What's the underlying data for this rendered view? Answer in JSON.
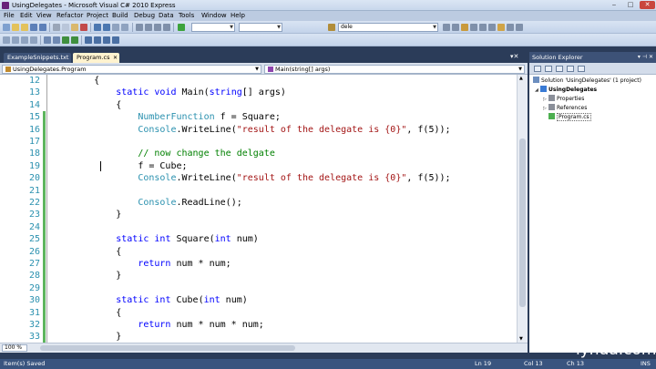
{
  "window": {
    "title": "UsingDelegates - Microsoft Visual C# 2010 Express",
    "controls": [
      "‒",
      "□",
      "✕"
    ]
  },
  "menu": [
    "File",
    "Edit",
    "View",
    "Refactor",
    "Project",
    "Build",
    "Debug",
    "Data",
    "Tools",
    "Window",
    "Help"
  ],
  "toolbar": {
    "find_value": "dele"
  },
  "tabs": [
    {
      "label": "ExampleSnippets.txt",
      "active": false
    },
    {
      "label": "Program.cs",
      "active": true
    }
  ],
  "navbar": {
    "type_value": "UsingDelegates.Program",
    "member_value": "Main(string[] args)"
  },
  "editor": {
    "line_numbers": [
      "12",
      "13",
      "14",
      "15",
      "16",
      "17",
      "18",
      "19",
      "20",
      "21",
      "22",
      "23",
      "24",
      "25",
      "26",
      "27",
      "28",
      "29",
      "30",
      "31",
      "32",
      "33"
    ],
    "zoom": "100 %"
  },
  "solution_explorer": {
    "title": "Solution Explorer",
    "items": [
      {
        "label": "Solution 'UsingDelegates' (1 project)"
      },
      {
        "label": "UsingDelegates"
      },
      {
        "label": "Properties"
      },
      {
        "label": "References"
      },
      {
        "label": "Program.cs"
      }
    ]
  },
  "status": {
    "message": "Item(s) Saved",
    "line": "Ln 19",
    "col": "Col 13",
    "ch": "Ch 13",
    "mode": "INS"
  },
  "watermark": "lynda.com",
  "colors": {
    "keyword": "#0000ff",
    "type": "#2b91af",
    "string": "#a31515",
    "comment": "#008000",
    "change_bar": "#5db55d"
  }
}
